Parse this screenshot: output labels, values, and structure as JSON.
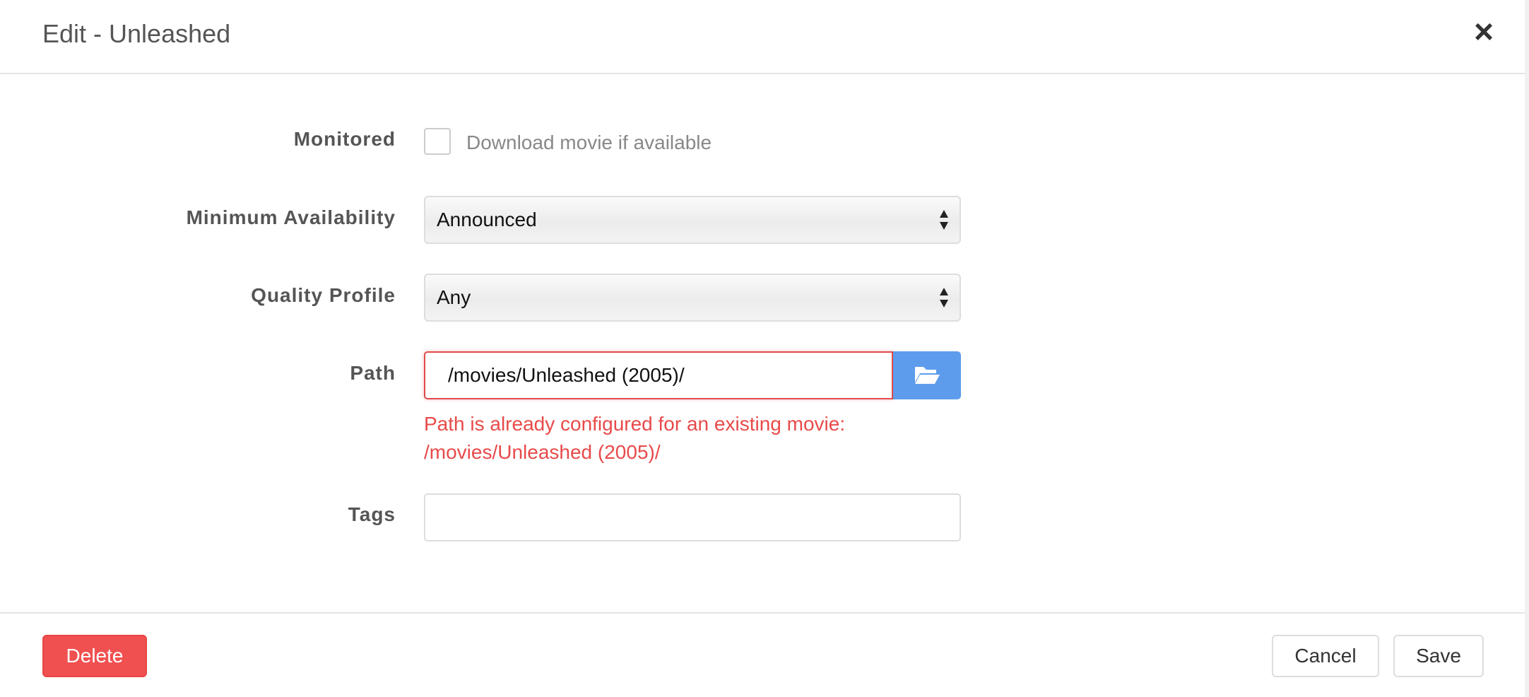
{
  "modal": {
    "title": "Edit - Unleashed",
    "close_icon": "close-icon"
  },
  "form": {
    "monitored": {
      "label": "Monitored",
      "checkbox_text": "Download movie if available",
      "checked": false
    },
    "minimum_availability": {
      "label": "Minimum Availability",
      "selected": "Announced"
    },
    "quality_profile": {
      "label": "Quality Profile",
      "selected": "Any"
    },
    "path": {
      "label": "Path",
      "value": "/movies/Unleashed (2005)/",
      "browse_icon": "folder-open-icon",
      "error_line1": "Path is already configured for an existing movie:",
      "error_line2": "/movies/Unleashed (2005)/"
    },
    "tags": {
      "label": "Tags",
      "value": ""
    }
  },
  "footer": {
    "delete_label": "Delete",
    "cancel_label": "Cancel",
    "save_label": "Save"
  },
  "colors": {
    "danger": "#f05050",
    "error_text": "#e84a4a",
    "primary": "#5d9cec"
  }
}
